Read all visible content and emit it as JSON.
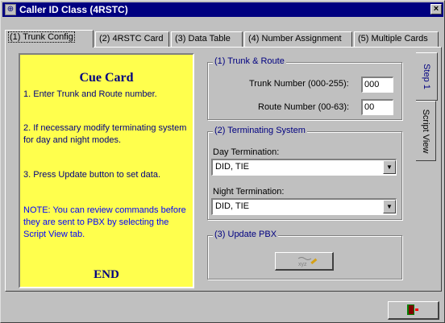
{
  "window": {
    "title": "Caller ID Class (4RSTC)",
    "close_glyph": "×"
  },
  "tabs": [
    {
      "label": "(1) Trunk Config",
      "active": true
    },
    {
      "label": "(2) 4RSTC Card"
    },
    {
      "label": "(3) Data Table"
    },
    {
      "label": "(4) Number Assignment"
    },
    {
      "label": "(5) Multiple Cards"
    }
  ],
  "cue_card": {
    "title": "Cue Card",
    "steps": [
      "1. Enter Trunk and Route number.",
      "2. If necessary modify terminating system for day and night modes.",
      "3. Press Update button to set data."
    ],
    "note": "NOTE: You can review commands before they are sent to PBX by selecting the Script View tab.",
    "end": "END"
  },
  "trunk_route": {
    "legend": "(1) Trunk & Route",
    "trunk_label": "Trunk Number (000-255):",
    "trunk_value": "000",
    "route_label": "Route Number (00-63):",
    "route_value": "00"
  },
  "terminating": {
    "legend": "(2) Terminating System",
    "day_label": "Day Termination:",
    "day_value": "DID, TIE",
    "night_label": "Night Termination:",
    "night_value": "DID, TIE"
  },
  "update": {
    "legend": "(3) Update PBX",
    "icon": "pencil-icon"
  },
  "side_tabs": [
    {
      "label": "Step 1",
      "active": true
    },
    {
      "label": "Script View"
    }
  ],
  "exit_icon": "door-exit-icon",
  "colors": {
    "titlebar": "#000080",
    "cue_bg": "#ffff4d",
    "cue_text": "#000080",
    "note_text": "#0000ff"
  }
}
